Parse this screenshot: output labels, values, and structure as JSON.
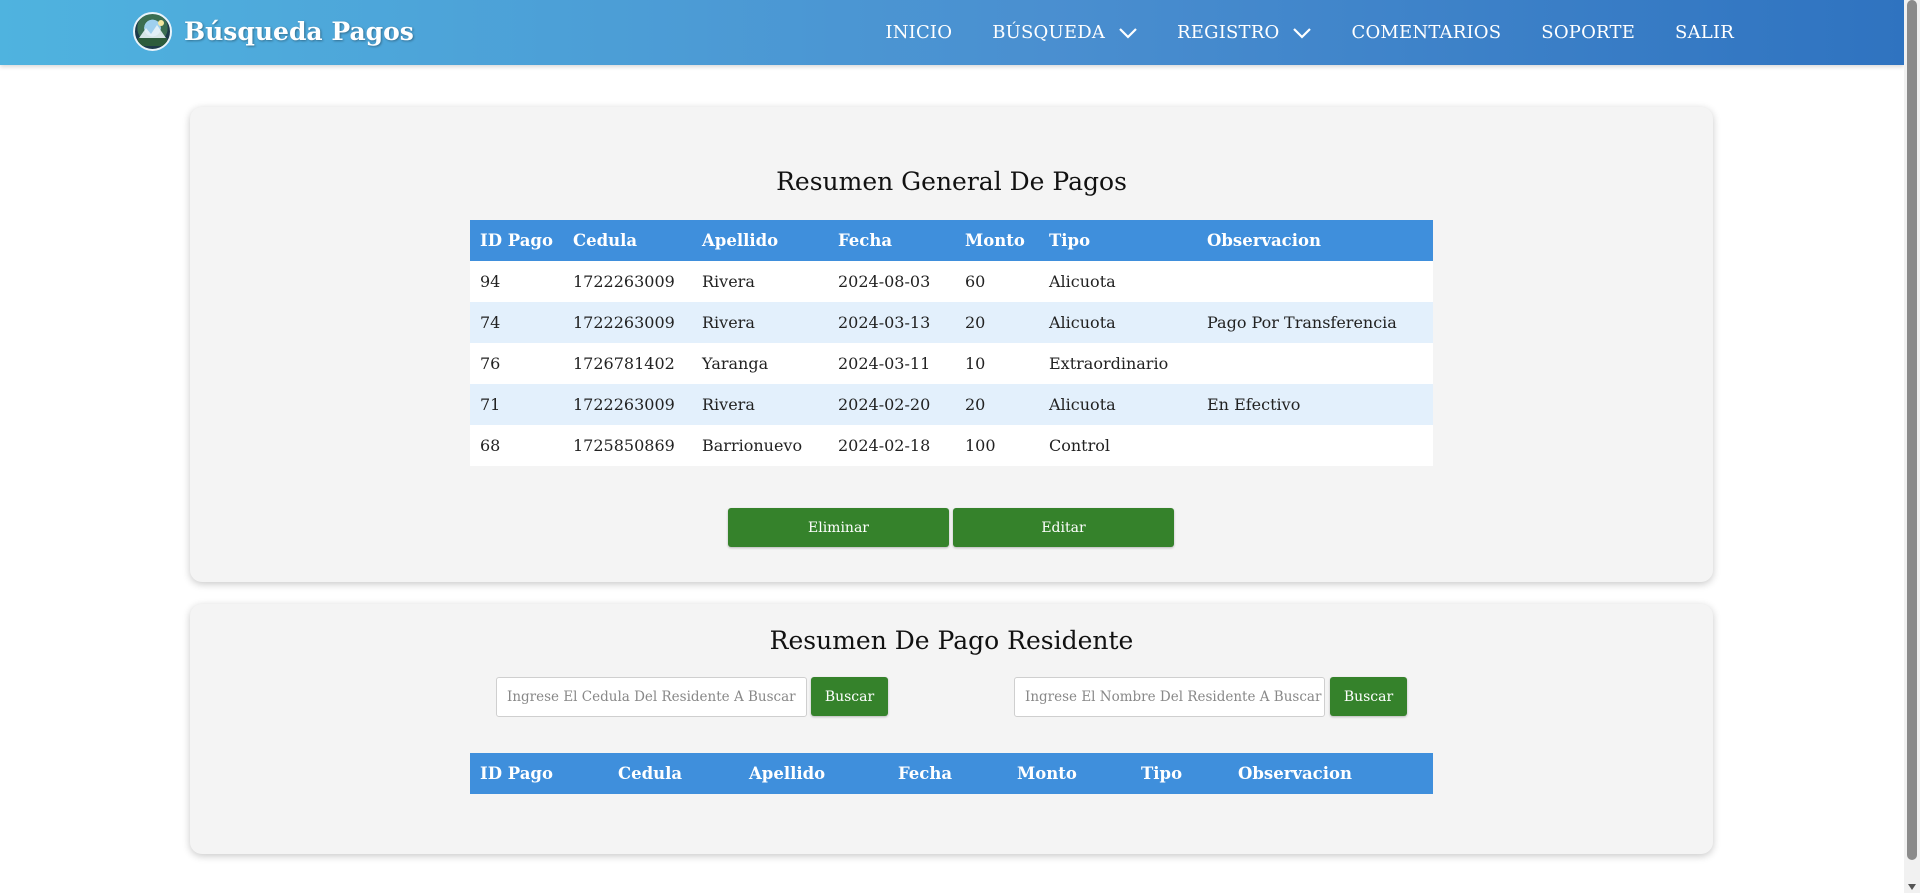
{
  "header": {
    "title": "Búsqueda Pagos",
    "nav": [
      {
        "label": "INICIO",
        "dropdown": false
      },
      {
        "label": "BÚSQUEDA",
        "dropdown": true
      },
      {
        "label": "REGISTRO",
        "dropdown": true
      },
      {
        "label": "COMENTARIOS",
        "dropdown": false
      },
      {
        "label": "SOPORTE",
        "dropdown": false
      },
      {
        "label": "SALIR",
        "dropdown": false
      }
    ]
  },
  "general": {
    "title": "Resumen General De Pagos",
    "columns": [
      "ID Pago",
      "Cedula",
      "Apellido",
      "Fecha",
      "Monto",
      "Tipo",
      "Observacion"
    ],
    "rows": [
      [
        "94",
        "1722263009",
        "Rivera",
        "2024-08-03",
        "60",
        "Alicuota",
        ""
      ],
      [
        "74",
        "1722263009",
        "Rivera",
        "2024-03-13",
        "20",
        "Alicuota",
        "Pago Por Transferencia"
      ],
      [
        "76",
        "1726781402",
        "Yaranga",
        "2024-03-11",
        "10",
        "Extraordinario",
        ""
      ],
      [
        "71",
        "1722263009",
        "Rivera",
        "2024-02-20",
        "20",
        "Alicuota",
        "En Efectivo"
      ],
      [
        "68",
        "1725850869",
        "Barrionuevo",
        "2024-02-18",
        "100",
        "Control",
        ""
      ]
    ],
    "delete_label": "Eliminar",
    "edit_label": "Editar"
  },
  "resident": {
    "title": "Resumen De Pago Residente",
    "cedula_placeholder": "Ingrese El Cedula Del Residente A Buscar",
    "nombre_placeholder": "Ingrese El Nombre Del Residente A Buscar",
    "search_label": "Buscar",
    "columns": [
      "ID Pago",
      "Cedula",
      "Apellido",
      "Fecha",
      "Monto",
      "Tipo",
      "Observacion"
    ]
  },
  "colors": {
    "header_start": "#4fb3df",
    "header_end": "#2f73c0",
    "table_header": "#3f8fdc",
    "button": "#35822b",
    "row_alt": "#e3f0fc"
  },
  "icons": {
    "logo": "community-logo-icon",
    "dropdown": "chevron-down-icon"
  }
}
